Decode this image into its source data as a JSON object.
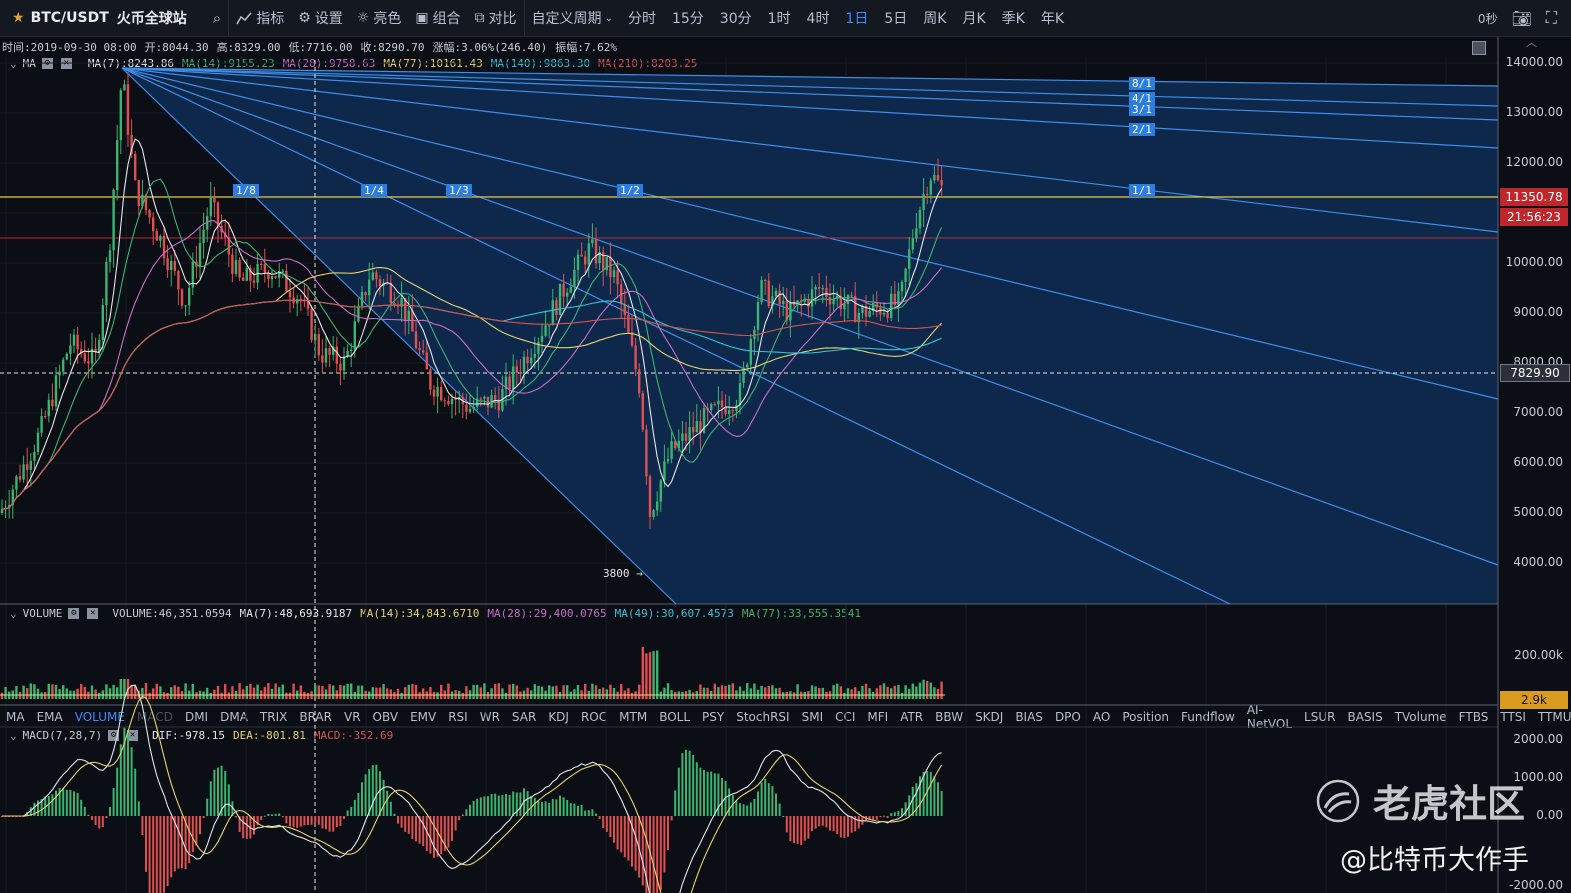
{
  "topbar": {
    "symbol": "BTC/USDT",
    "exchange": "火币全球站",
    "indicators_label": "指标",
    "settings_label": "设置",
    "theme_label": "亮色",
    "combine_label": "组合",
    "compare_label": "对比",
    "custom_period_label": "自定义周期",
    "periods": [
      "分时",
      "15分",
      "30分",
      "1时",
      "4时",
      "1日",
      "5日",
      "周K",
      "月K",
      "季K",
      "年K"
    ],
    "active_period": "1日",
    "countdown": "0秒"
  },
  "ohlc": {
    "time": "时间:2019-09-30 08:00",
    "open": "开:8044.30",
    "high": "高:8329.00",
    "low": "低:7716.00",
    "close": "收:8290.70",
    "change": "涨幅:3.06%(246.40)",
    "amplitude": "振幅:7.62%"
  },
  "ma_legend": {
    "name": "MA",
    "ma7": "MA(7):8243.86",
    "ma14": "MA(14):9155.23",
    "ma28": "MA(28):9758.63",
    "ma77": "MA(77):10161.43",
    "ma140": "MA(140):9863.30",
    "ma210": "MA(210):8203.25"
  },
  "volume_legend": {
    "name": "VOLUME",
    "volume": "VOLUME:46,351.0594",
    "ma7": "MA(7):48,693.9187",
    "ma14": "MA(14):34,843.6710",
    "ma28": "MA(28):29,400.0765",
    "ma49": "MA(49):30,607.4573",
    "ma77": "MA(77):33,555.3541"
  },
  "macd_legend": {
    "name": "MACD(7,28,7)",
    "dif": "DIF:-978.15",
    "dea": "DEA:-801.81",
    "macd": "MACD:-352.69"
  },
  "indicator_tabs": [
    "MA",
    "EMA",
    "VOLUME",
    "MACD",
    "DMI",
    "DMA",
    "TRIX",
    "BRAR",
    "VR",
    "OBV",
    "EMV",
    "RSI",
    "WR",
    "SAR",
    "KDJ",
    "ROC",
    "MTM",
    "BOLL",
    "PSY",
    "StochRSI",
    "SMI",
    "CCI",
    "MFI",
    "ATR",
    "BBW",
    "SKDJ",
    "BIAS",
    "DPO",
    "AO",
    "Position",
    "Fundflow",
    "AI-NetVOL",
    "LSUR",
    "BASIS",
    "TVolume",
    "FTBS",
    "TTSI",
    "TTMU"
  ],
  "active_tab": "VOLUME",
  "dim_tab": "MACD",
  "price_axis": [
    "14000.00",
    "13000.00",
    "12000.00",
    "10000.00",
    "9000.00",
    "8000.00",
    "7000.00",
    "6000.00",
    "5000.00",
    "4000.00"
  ],
  "price_tags": {
    "current": "11350.78",
    "countdown": "21:56:23",
    "crosshair": "7829.90"
  },
  "volume_axis": {
    "tick": "200.00k",
    "current": "2.9k"
  },
  "macd_axis": [
    "2000.00",
    "1000.00",
    "0.00",
    "-2000.00"
  ],
  "gann_labels": [
    "1/8",
    "1/4",
    "1/3",
    "1/2",
    "1/1",
    "2/1",
    "3/1",
    "4/1",
    "8/1"
  ],
  "low_marker": "3800",
  "watermark": {
    "brand": "老虎社区",
    "handle": "@比特币大作手"
  },
  "colors": {
    "background": "#0b0e14",
    "accent": "#3d8bff",
    "gann_fill": "#0e2a4e",
    "gann_line": "#3f8ee8",
    "up": "#3cb371",
    "down": "#e05050",
    "ma7": "#e6e6e6",
    "ma14": "#3cb371",
    "ma28": "#c86ec8",
    "ma77": "#e6d36e",
    "ma140": "#35c3d6",
    "ma210": "#d9534f"
  }
}
